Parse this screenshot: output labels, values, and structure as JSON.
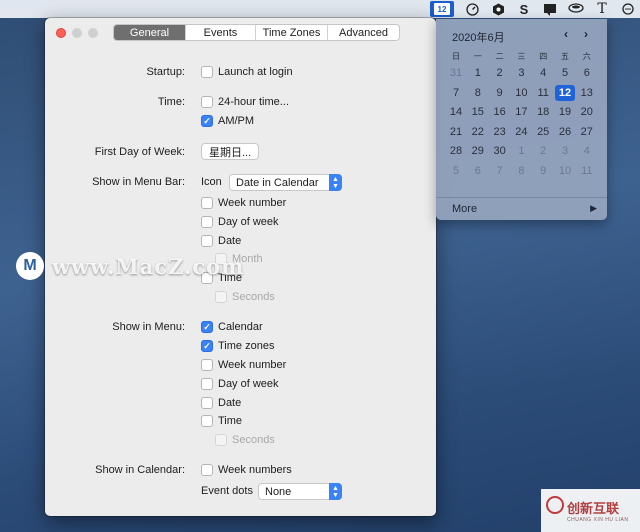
{
  "menubar": {
    "calendar_day": "12",
    "icons": [
      "calendar-day-icon",
      "speedometer-icon",
      "hexagon-icon",
      "s-app-icon",
      "slack-icon",
      "cup-icon",
      "typeface-icon",
      "chat-icon"
    ],
    "typeface_glyph": "T",
    "s_glyph": "S"
  },
  "window": {
    "tabs": [
      "General",
      "Events",
      "Time Zones",
      "Advanced"
    ],
    "active_tab": "General",
    "startup": {
      "label": "Startup:",
      "option": "Launch at login",
      "checked": false
    },
    "time": {
      "label": "Time:",
      "options": [
        {
          "text": "24-hour time...",
          "checked": false
        },
        {
          "text": "AM/PM",
          "checked": true
        }
      ]
    },
    "first_day": {
      "label": "First Day of Week:",
      "value": "星期日..."
    },
    "show_in_menubar": {
      "label": "Show in Menu Bar:",
      "icon_label": "Icon",
      "icon_value": "Date in Calendar",
      "options": [
        {
          "text": "Week number",
          "checked": false
        },
        {
          "text": "Day of week",
          "checked": false
        },
        {
          "text": "Date",
          "checked": false
        },
        {
          "text": "Month",
          "checked": false,
          "disabled": true
        },
        {
          "text": "Time",
          "checked": false
        },
        {
          "text": "Seconds",
          "checked": false,
          "disabled": true
        }
      ]
    },
    "show_in_menu": {
      "label": "Show in Menu:",
      "options": [
        {
          "text": "Calendar",
          "checked": true
        },
        {
          "text": "Time zones",
          "checked": true
        },
        {
          "text": "Week number",
          "checked": false
        },
        {
          "text": "Day of week",
          "checked": false
        },
        {
          "text": "Date",
          "checked": false
        },
        {
          "text": "Time",
          "checked": false
        },
        {
          "text": "Seconds",
          "checked": false,
          "disabled": true
        }
      ]
    },
    "show_in_calendar": {
      "label": "Show in Calendar:",
      "week_numbers": {
        "text": "Week numbers",
        "checked": false
      },
      "event_dots_label": "Event dots",
      "event_dots_value": "None"
    }
  },
  "calendar": {
    "title": "2020年6月",
    "prev": "‹",
    "next": "›",
    "weekdays": [
      "日",
      "一",
      "二",
      "三",
      "四",
      "五",
      "六"
    ],
    "weeks": [
      [
        "31",
        "1",
        "2",
        "3",
        "4",
        "5",
        "6"
      ],
      [
        "7",
        "8",
        "9",
        "10",
        "11",
        "12",
        "13"
      ],
      [
        "14",
        "15",
        "16",
        "17",
        "18",
        "19",
        "20"
      ],
      [
        "21",
        "22",
        "23",
        "24",
        "25",
        "26",
        "27"
      ],
      [
        "28",
        "29",
        "30",
        "1",
        "2",
        "3",
        "4"
      ],
      [
        "5",
        "6",
        "7",
        "8",
        "9",
        "10",
        "11"
      ]
    ],
    "today": "12",
    "more_label": "More",
    "more_arrow": "▶"
  },
  "watermark": {
    "logo_letter": "M",
    "text": "www.MacZ.com",
    "corner_text": "创新互联",
    "corner_sub": "CHUANG XIN HU LIAN"
  },
  "colors": {
    "accent": "#3b82f6",
    "today": "#1f63d9",
    "close": "#fe5f57"
  }
}
